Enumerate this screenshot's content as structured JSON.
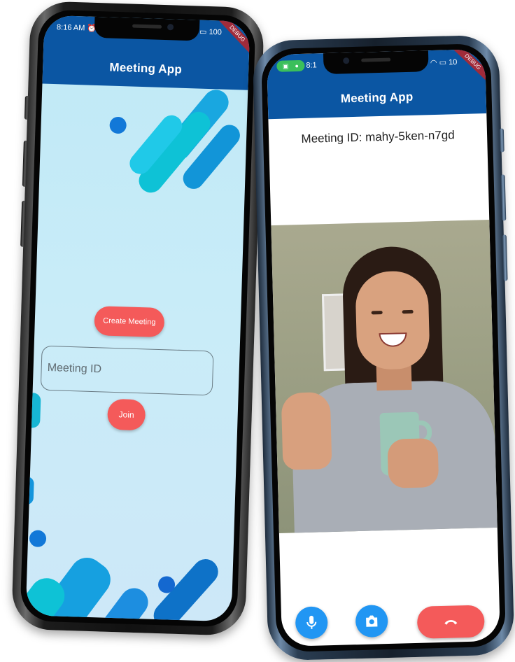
{
  "colors": {
    "appbar": "#0b56a3",
    "primary_button": "#f45a5a",
    "control_button": "#2196f3",
    "background_light": "#c9ecf8"
  },
  "left_phone": {
    "status_bar": {
      "time": "8:16 AM",
      "battery": "100",
      "alarm_icon": "alarm-icon"
    },
    "debug_banner": "DEBUG",
    "app_title": "Meeting App",
    "create_button_label": "Create Meeting",
    "meeting_id_input": {
      "placeholder": "Meeting ID",
      "value": ""
    },
    "join_button_label": "Join"
  },
  "right_phone": {
    "status_bar": {
      "time": "8:1",
      "battery": "10",
      "indicators": [
        "camera-indicator-icon",
        "mic-indicator-icon"
      ]
    },
    "debug_banner": "DEBUG",
    "app_title": "Meeting App",
    "meeting_id_text": "Meeting ID: mahy-5ken-n7gd",
    "controls": {
      "mic": "mic-icon",
      "camera": "camera-switch-icon",
      "end_call": "end-call-icon"
    }
  }
}
